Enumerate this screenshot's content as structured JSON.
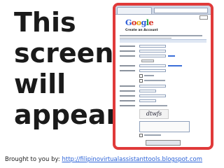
{
  "slide": {
    "headline": [
      "This",
      "screen",
      "will",
      "appear"
    ],
    "footer_prefix": "Brought to you by: ",
    "footer_link": "http://filipinovirtualassistanttools.blogspot.com"
  },
  "screenshot": {
    "logo_letters": [
      "G",
      "o",
      "o",
      "g",
      "l",
      "e"
    ],
    "page_heading": "Create an Account",
    "captcha_text": "dtwfs"
  },
  "colors": {
    "frame_border": "#e03a3a",
    "link": "#2a62d8"
  }
}
